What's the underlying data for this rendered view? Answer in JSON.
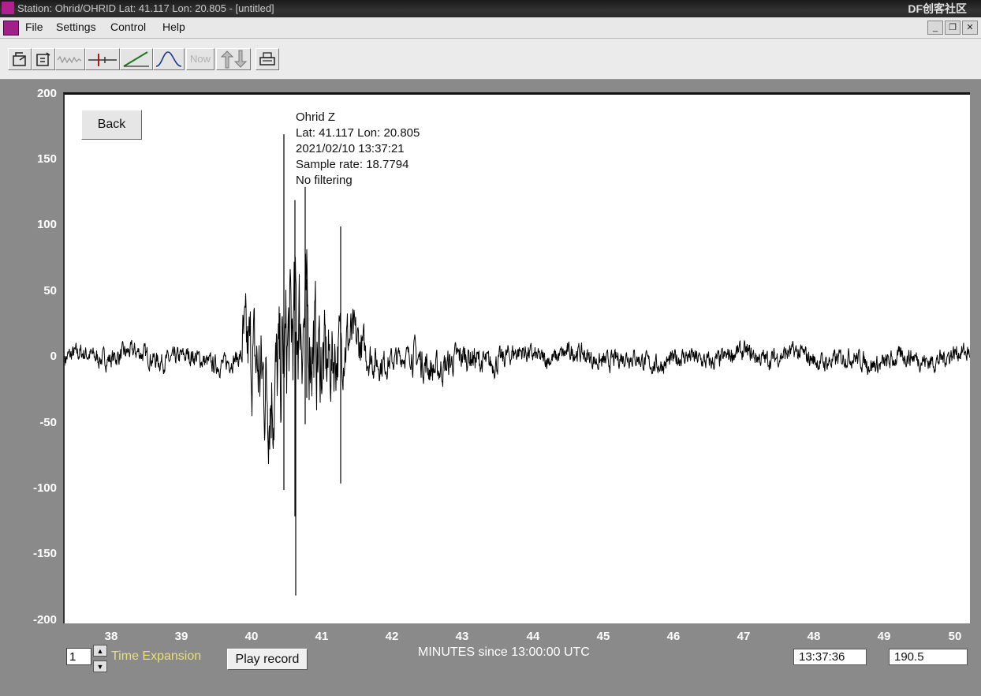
{
  "window": {
    "title": "Station: Ohrid/OHRID Lat: 41.117 Lon: 20.805 - [untitled]",
    "brand": "DF创客社区"
  },
  "menu": {
    "items": [
      "File",
      "Settings",
      "Control",
      "Help"
    ]
  },
  "toolbar": {
    "now_label": "Now"
  },
  "plot": {
    "back_label": "Back",
    "info": [
      "Ohrid  Z",
      "Lat: 41.117 Lon: 20.805",
      "2021/02/10 13:37:21",
      "Sample rate: 18.7794",
      "No filtering"
    ],
    "y_ticks": [
      "200",
      "150",
      "100",
      "50",
      "0",
      "-50",
      "-100",
      "-150",
      "-200"
    ],
    "x_ticks": [
      "38",
      "39",
      "40",
      "41",
      "42",
      "43",
      "44",
      "45",
      "46",
      "47",
      "48",
      "49",
      "50"
    ]
  },
  "controls": {
    "time_expansion_value": "1",
    "time_expansion_label": "Time Expansion",
    "play_label": "Play record",
    "x_axis_title": "MINUTES since 13:00:00 UTC",
    "time_readout": "13:37:36",
    "value_readout": "190.5"
  }
}
